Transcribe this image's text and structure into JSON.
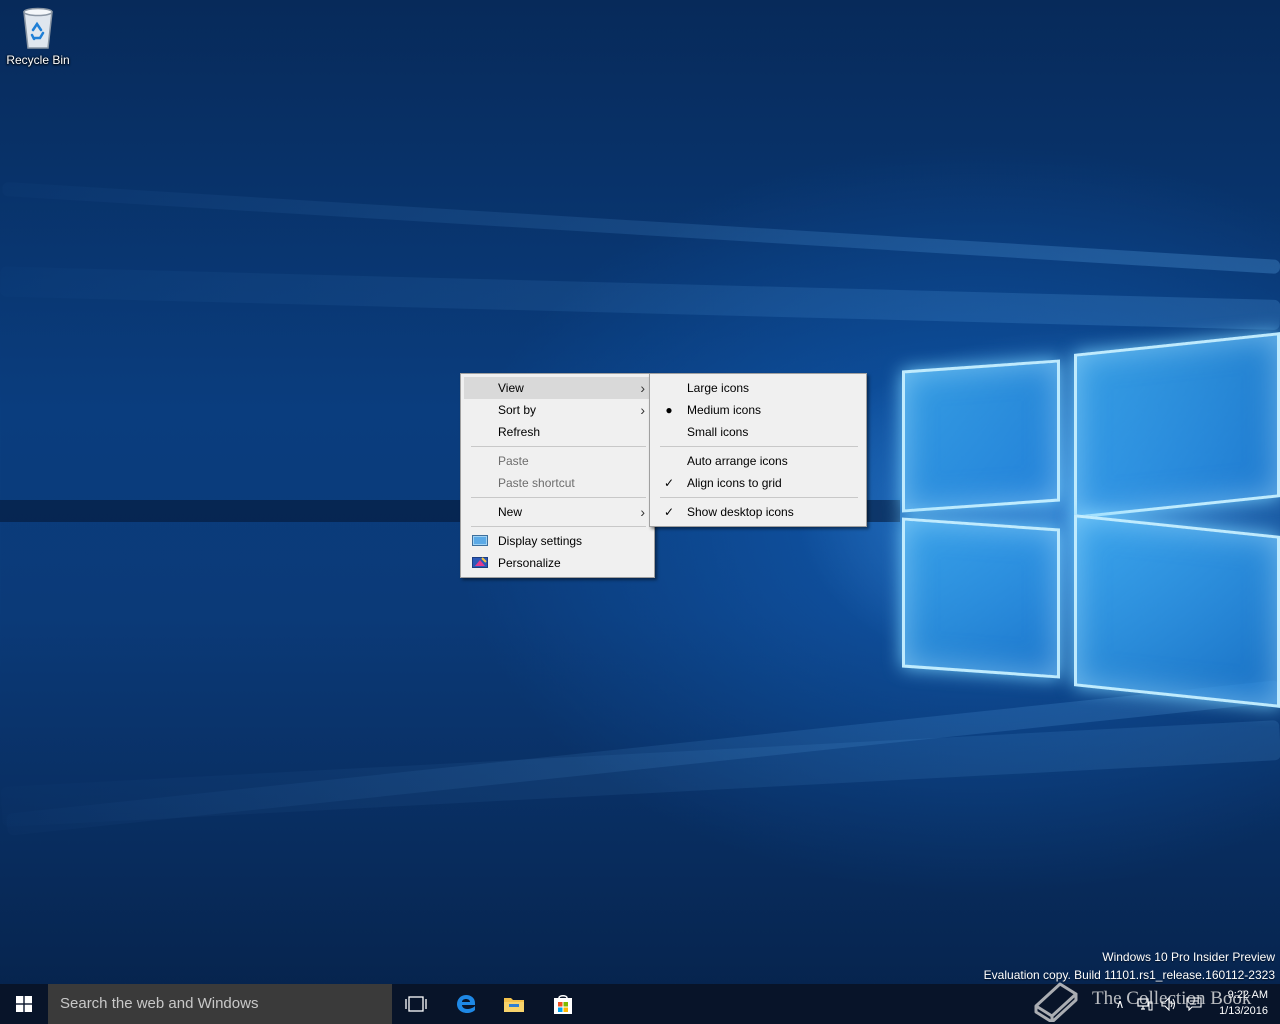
{
  "desktop": {
    "icons": [
      {
        "label": "Recycle Bin"
      }
    ]
  },
  "context_menu": {
    "items": [
      {
        "label": "View",
        "has_submenu": true,
        "highlighted": true
      },
      {
        "label": "Sort by",
        "has_submenu": true
      },
      {
        "label": "Refresh"
      },
      {
        "label": "Paste",
        "disabled": true
      },
      {
        "label": "Paste shortcut",
        "disabled": true
      },
      {
        "label": "New",
        "has_submenu": true
      },
      {
        "label": "Display settings",
        "icon": "display-settings-icon"
      },
      {
        "label": "Personalize",
        "icon": "personalize-icon"
      }
    ]
  },
  "view_submenu": {
    "items": [
      {
        "label": "Large icons"
      },
      {
        "label": "Medium icons",
        "selected": true
      },
      {
        "label": "Small icons"
      },
      {
        "label": "Auto arrange icons"
      },
      {
        "label": "Align icons to grid",
        "checked": true
      },
      {
        "label": "Show desktop icons",
        "checked": true
      }
    ]
  },
  "watermark": {
    "line1": "Windows 10 Pro Insider Preview",
    "line2": "Evaluation copy. Build 11101.rs1_release.160112-2323"
  },
  "taskbar": {
    "search_placeholder": "Search the web and Windows",
    "pinned": [
      "task-view-icon",
      "edge-icon",
      "file-explorer-icon",
      "store-icon"
    ],
    "clock": {
      "time": "9:22 AM",
      "date": "1/13/2016"
    }
  },
  "overlay": {
    "brand": "The Collection Book"
  }
}
